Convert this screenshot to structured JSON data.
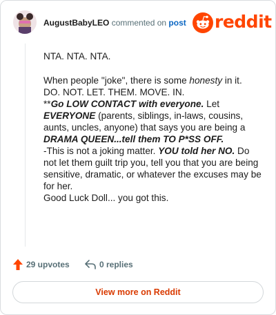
{
  "header": {
    "username": "AugustBabyLEO",
    "commented_text": "commented on",
    "post_link": "post",
    "logo_text": "reddit"
  },
  "comment": {
    "line1": "NTA. NTA. NTA.",
    "line2_a": "When people \"joke\", there is some ",
    "line2_b": "honesty",
    "line2_c": " in it.",
    "line3": "DO. NOT. LET. THEM. MOVE. IN.",
    "line4_a": "**",
    "line4_b": "Go LOW CONTACT with everyone.",
    "line4_c": " Let ",
    "line4_d": "EVERYONE",
    "line4_e": " (parents, siblings, in-laws, cousins, aunts, uncles, anyone) that says you are being a ",
    "line4_f": "DRAMA QUEEN...tell them TO P*SS OFF.",
    "line5_a": "-This is not a joking matter. ",
    "line5_b": "YOU told her NO.",
    "line5_c": " Do not let them guilt trip you, tell you that you are being sensitive, dramatic, or whatever the excuses may be for her.",
    "line6": "Good Luck Doll... you got this."
  },
  "actions": {
    "upvotes": "29 upvotes",
    "replies": "0 replies"
  },
  "footer": {
    "view_more": "View more on Reddit"
  },
  "colors": {
    "brand": "#ff4500",
    "upvote": "#ff4500",
    "link": "#0a66c2",
    "button_text": "#d93a00"
  },
  "icons": {
    "upvote": "arrow-up-icon",
    "reply": "reply-arrow-icon",
    "logo": "reddit-snoo-icon"
  }
}
